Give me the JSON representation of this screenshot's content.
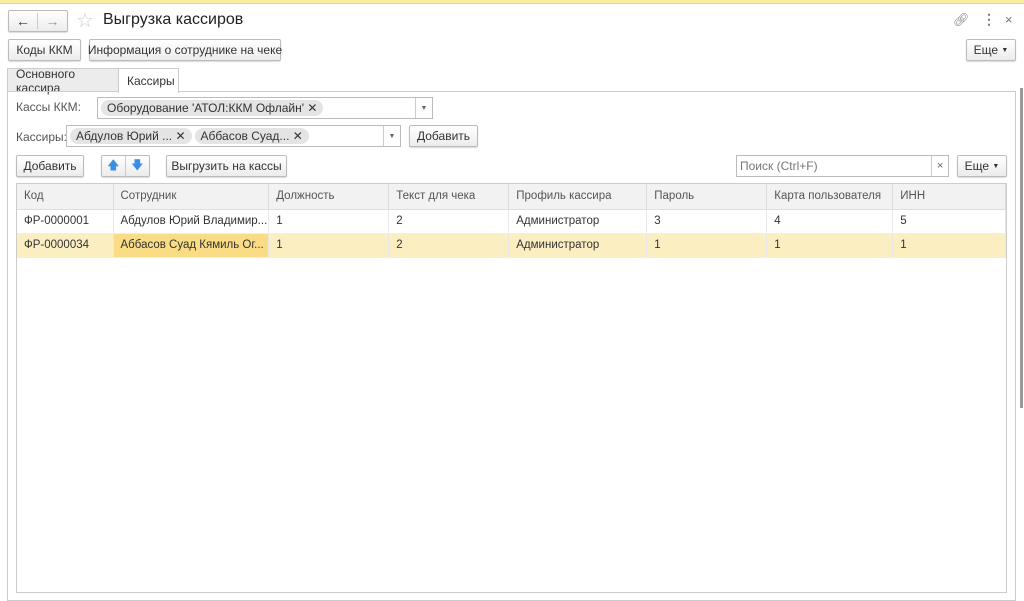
{
  "window": {
    "title": "Выгрузка кассиров"
  },
  "toolbar": {
    "codes_label": "Коды ККМ",
    "info_label": "Информация о сотруднике на чеке",
    "more_label": "Еще"
  },
  "tabs": [
    {
      "label": "Основного кассира"
    },
    {
      "label": "Кассиры"
    }
  ],
  "filters": {
    "kkm_label": "Кассы ККМ:",
    "kkm_chips": [
      "Оборудование 'АТОЛ:ККМ Офлайн'"
    ],
    "cashiers_label": "Кассиры:",
    "cashier_chips": [
      "Абдулов Юрий ...",
      "Аббасов Суад..."
    ],
    "add_label": "Добавить"
  },
  "list_toolbar": {
    "add_label": "Добавить",
    "upload_label": "Выгрузить на кассы",
    "search_placeholder": "Поиск (Ctrl+F)",
    "more_label": "Еще"
  },
  "table": {
    "columns": [
      "Код",
      "Сотрудник",
      "Должность",
      "Текст для чека",
      "Профиль кассира",
      "Пароль",
      "Карта пользователя",
      "ИНН"
    ],
    "rows": [
      [
        "ФР-0000001",
        "Абдулов Юрий Владимир...",
        "1",
        "2",
        "Администратор",
        "3",
        "4",
        "5"
      ],
      [
        "ФР-0000034",
        "Аббасов Суад Кямиль Ог...",
        "1",
        "2",
        "Администратор",
        "1",
        "1",
        "1"
      ]
    ]
  }
}
